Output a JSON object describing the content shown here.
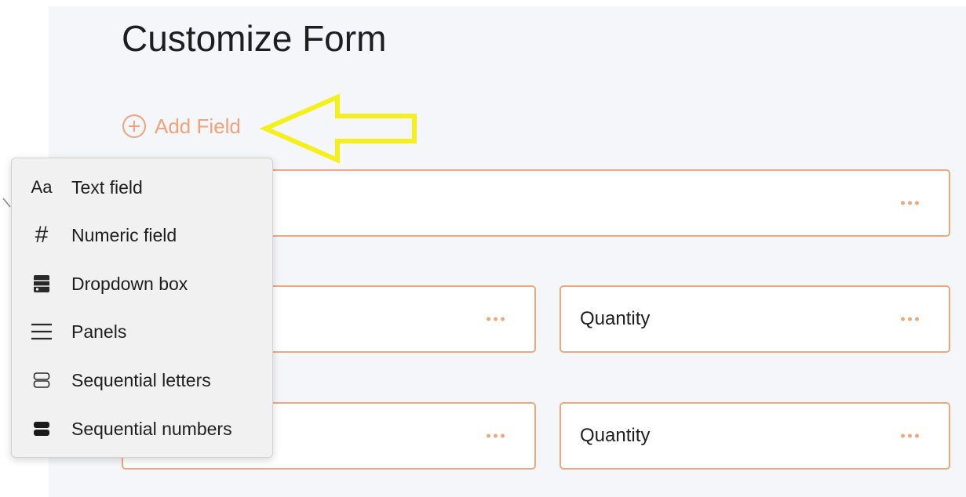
{
  "page": {
    "title": "Customize Form",
    "add_field_label": "Add Field"
  },
  "colors": {
    "accent": "#f0a77c",
    "annotation_arrow": "#f5ef1e",
    "panel_background": "#f4f6f9"
  },
  "fields": [
    {
      "label": "",
      "menu_icon": "more-icon"
    },
    {
      "label": "",
      "menu_icon": "more-icon"
    },
    {
      "label": "Quantity",
      "menu_icon": "more-icon"
    },
    {
      "label": "",
      "menu_icon": "more-icon"
    },
    {
      "label": "Quantity",
      "menu_icon": "more-icon"
    }
  ],
  "field_type_menu": {
    "items": [
      {
        "label": "Text field",
        "icon": "text-field-icon",
        "glyph": "Aa"
      },
      {
        "label": "Numeric field",
        "icon": "numeric-field-icon",
        "glyph": "#"
      },
      {
        "label": "Dropdown box",
        "icon": "dropdown-box-icon"
      },
      {
        "label": "Panels",
        "icon": "panels-icon"
      },
      {
        "label": "Sequential letters",
        "icon": "sequential-letters-icon"
      },
      {
        "label": "Sequential numbers",
        "icon": "sequential-numbers-icon"
      }
    ]
  }
}
